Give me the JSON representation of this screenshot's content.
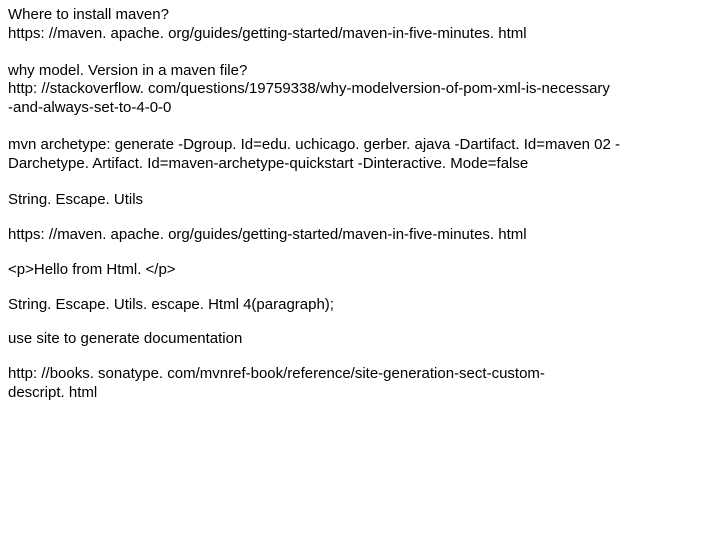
{
  "blocks": [
    {
      "lines": [
        "Where to install maven?",
        "https: //maven. apache. org/guides/getting-started/maven-in-five-minutes. html"
      ]
    },
    {
      "lines": [
        "why model. Version in a maven file?",
        "http: //stackoverflow. com/questions/19759338/why-modelversion-of-pom-xml-is-necessary",
        "-and-always-set-to-4-0-0"
      ]
    },
    {
      "lines": [
        "mvn archetype: generate -Dgroup. Id=edu. uchicago. gerber. ajava -Dartifact. Id=maven 02 -",
        "Darchetype. Artifact. Id=maven-archetype-quickstart -Dinteractive. Mode=false"
      ]
    },
    {
      "lines": [
        "String. Escape. Utils"
      ]
    },
    {
      "lines": [
        "https: //maven. apache. org/guides/getting-started/maven-in-five-minutes. html"
      ]
    },
    {
      "lines": [
        "<p>Hello from Html. </p>"
      ]
    },
    {
      "lines": [
        "String. Escape. Utils. escape. Html 4(paragraph);"
      ]
    },
    {
      "lines": [
        "use site to generate documentation"
      ]
    },
    {
      "lines": [
        "http: //books. sonatype. com/mvnref-book/reference/site-generation-sect-custom-",
        "descript. html"
      ]
    }
  ]
}
